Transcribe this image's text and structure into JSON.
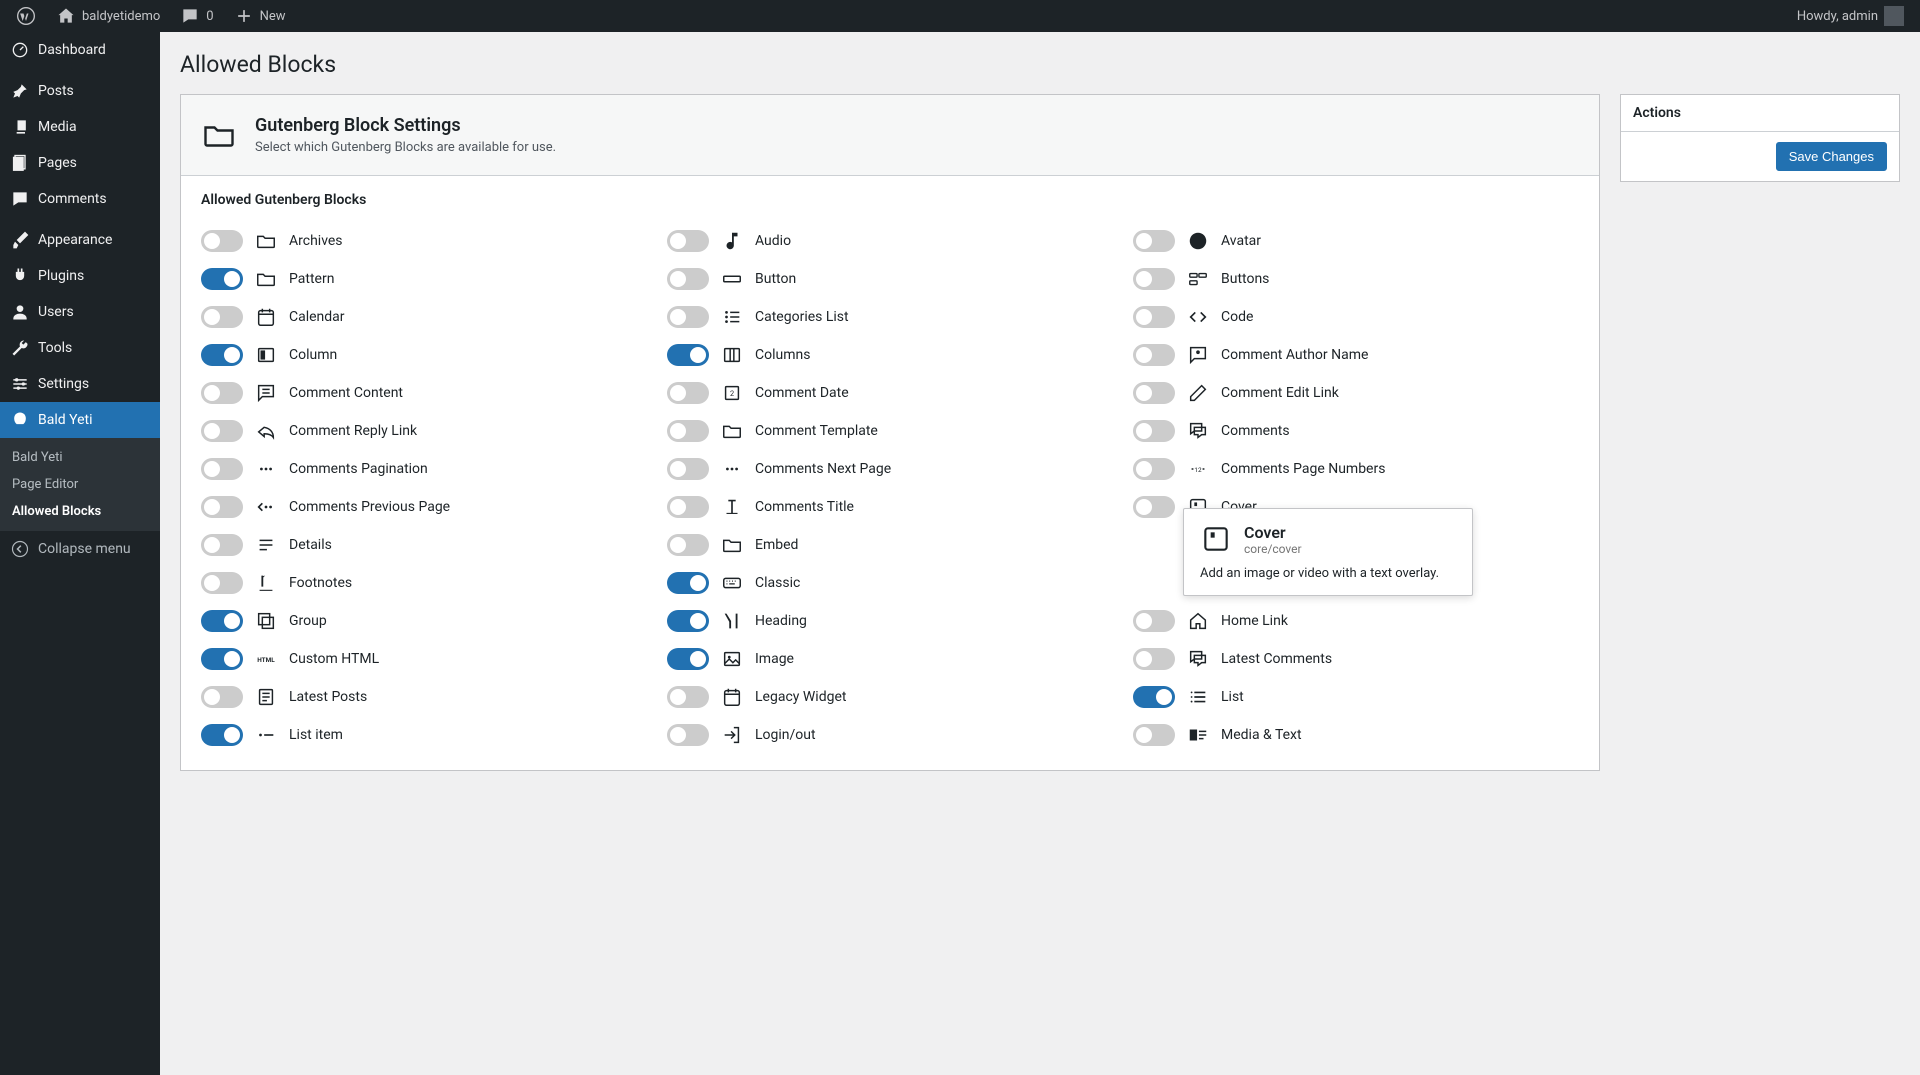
{
  "adminbar": {
    "site_name": "baldyetidemo",
    "comment_count": "0",
    "new_label": "New",
    "howdy": "Howdy, admin"
  },
  "sidebar": {
    "items": [
      {
        "label": "Dashboard",
        "icon": "dashboard"
      },
      {
        "label": "Posts",
        "icon": "pin"
      },
      {
        "label": "Media",
        "icon": "media"
      },
      {
        "label": "Pages",
        "icon": "pages"
      },
      {
        "label": "Comments",
        "icon": "comment"
      },
      {
        "label": "Appearance",
        "icon": "brush"
      },
      {
        "label": "Plugins",
        "icon": "plug"
      },
      {
        "label": "Users",
        "icon": "user"
      },
      {
        "label": "Tools",
        "icon": "wrench"
      },
      {
        "label": "Settings",
        "icon": "sliders"
      },
      {
        "label": "Bald Yeti",
        "icon": "yeti"
      }
    ],
    "submenu": [
      {
        "label": "Bald Yeti",
        "current": false
      },
      {
        "label": "Page Editor",
        "current": false
      },
      {
        "label": "Allowed Blocks",
        "current": true
      }
    ],
    "collapse_label": "Collapse menu"
  },
  "page": {
    "title": "Allowed Blocks",
    "card_title": "Gutenberg Block Settings",
    "card_sub": "Select which Gutenberg Blocks are available for use.",
    "section_title": "Allowed Gutenberg Blocks"
  },
  "actions": {
    "title": "Actions",
    "save_label": "Save Changes"
  },
  "blocks": [
    {
      "label": "Archives",
      "on": false,
      "icon": "folder"
    },
    {
      "label": "Audio",
      "on": false,
      "icon": "audio"
    },
    {
      "label": "Avatar",
      "on": false,
      "icon": "avatar"
    },
    {
      "label": "Pattern",
      "on": true,
      "icon": "folder"
    },
    {
      "label": "Button",
      "on": false,
      "icon": "button"
    },
    {
      "label": "Buttons",
      "on": false,
      "icon": "buttons"
    },
    {
      "label": "Calendar",
      "on": false,
      "icon": "calendar"
    },
    {
      "label": "Categories List",
      "on": false,
      "icon": "categories"
    },
    {
      "label": "Code",
      "on": false,
      "icon": "code"
    },
    {
      "label": "Column",
      "on": true,
      "icon": "column"
    },
    {
      "label": "Columns",
      "on": true,
      "icon": "columns"
    },
    {
      "label": "Comment Author Name",
      "on": false,
      "icon": "comment-author"
    },
    {
      "label": "Comment Content",
      "on": false,
      "icon": "comment-content"
    },
    {
      "label": "Comment Date",
      "on": false,
      "icon": "comment-date"
    },
    {
      "label": "Comment Edit Link",
      "on": false,
      "icon": "edit"
    },
    {
      "label": "Comment Reply Link",
      "on": false,
      "icon": "reply"
    },
    {
      "label": "Comment Template",
      "on": false,
      "icon": "folder"
    },
    {
      "label": "Comments",
      "on": false,
      "icon": "comments"
    },
    {
      "label": "Comments Pagination",
      "on": false,
      "icon": "dots"
    },
    {
      "label": "Comments Next Page",
      "on": false,
      "icon": "dots"
    },
    {
      "label": "Comments Page Numbers",
      "on": false,
      "icon": "page-nums"
    },
    {
      "label": "Comments Previous Page",
      "on": false,
      "icon": "dots-prev"
    },
    {
      "label": "Comments Title",
      "on": false,
      "icon": "title"
    },
    {
      "label": "Cover",
      "on": false,
      "icon": "cover",
      "tooltip": true
    },
    {
      "label": "Details",
      "on": false,
      "icon": "details"
    },
    {
      "label": "Embed",
      "on": false,
      "icon": "folder"
    },
    {
      "label": "",
      "on": false,
      "icon": "",
      "hidden": true
    },
    {
      "label": "Footnotes",
      "on": false,
      "icon": "footnotes"
    },
    {
      "label": "Classic",
      "on": true,
      "icon": "keyboard"
    },
    {
      "label": "",
      "on": false,
      "icon": "",
      "hidden": true
    },
    {
      "label": "Group",
      "on": true,
      "icon": "group"
    },
    {
      "label": "Heading",
      "on": true,
      "icon": "heading"
    },
    {
      "label": "Home Link",
      "on": false,
      "icon": "home"
    },
    {
      "label": "Custom HTML",
      "on": true,
      "icon": "html"
    },
    {
      "label": "Image",
      "on": true,
      "icon": "image"
    },
    {
      "label": "Latest Comments",
      "on": false,
      "icon": "comments"
    },
    {
      "label": "Latest Posts",
      "on": false,
      "icon": "posts"
    },
    {
      "label": "Legacy Widget",
      "on": false,
      "icon": "calendar"
    },
    {
      "label": "List",
      "on": true,
      "icon": "list"
    },
    {
      "label": "List item",
      "on": true,
      "icon": "list-item"
    },
    {
      "label": "Login/out",
      "on": false,
      "icon": "login"
    },
    {
      "label": "Media & Text",
      "on": false,
      "icon": "media-text"
    }
  ],
  "tooltip": {
    "title": "Cover",
    "slug": "core/cover",
    "desc": "Add an image or video with a text overlay."
  }
}
